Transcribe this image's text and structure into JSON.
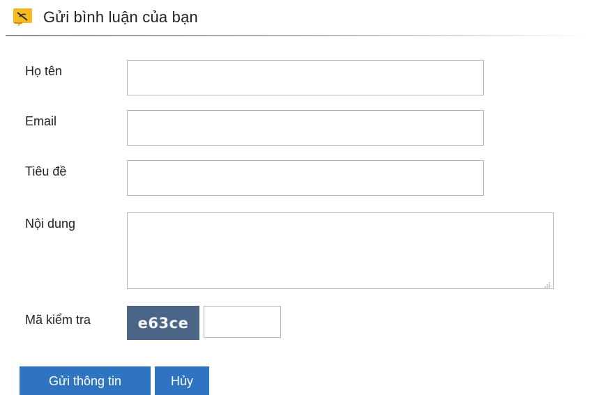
{
  "header": {
    "title": "Gửi bình luận của bạn",
    "icon": "comment-pen-icon"
  },
  "form": {
    "name_label": "Họ tên",
    "name_value": "",
    "email_label": "Email",
    "email_value": "",
    "subject_label": "Tiêu đề",
    "subject_value": "",
    "content_label": "Nội dung",
    "content_value": "",
    "captcha_label": "Mã kiểm tra",
    "captcha_code": "e63ce",
    "captcha_value": ""
  },
  "buttons": {
    "submit_label": "Gửi thông tin",
    "cancel_label": "Hủy"
  },
  "colors": {
    "button": "#2f74c1",
    "captcha_bg": "#4a6586",
    "icon_bg": "#f5b921"
  }
}
